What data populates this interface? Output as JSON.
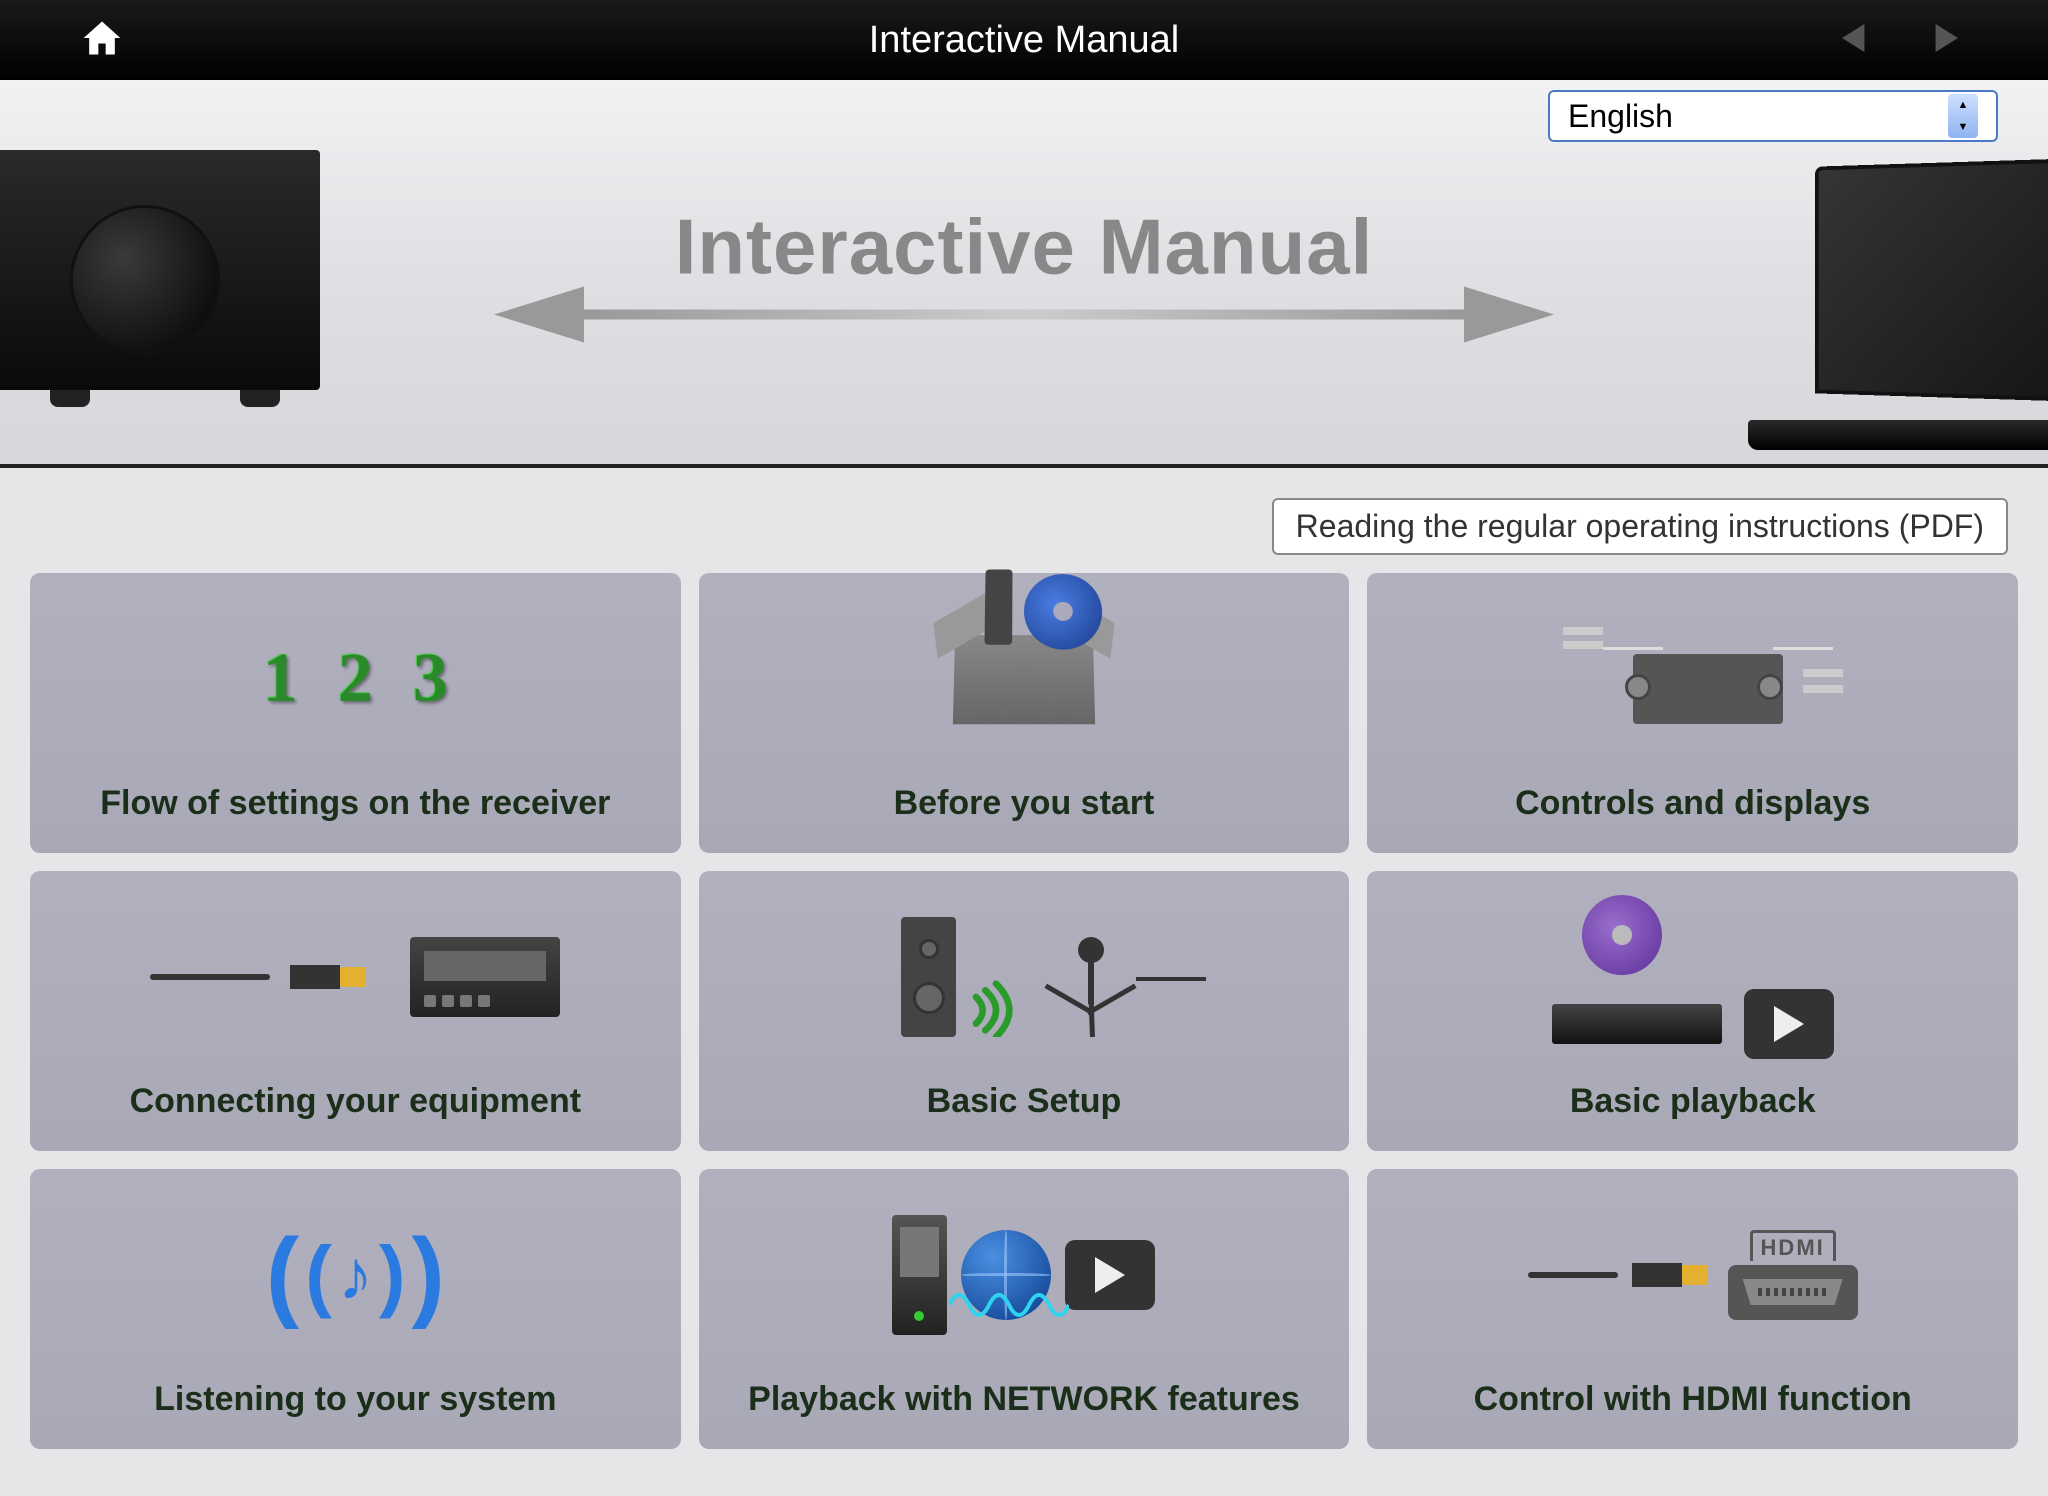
{
  "topbar": {
    "title": "Interactive Manual"
  },
  "language": {
    "selected": "English"
  },
  "hero": {
    "title": "Interactive Manual"
  },
  "pdf_link": "Reading the regular operating instructions (PDF)",
  "cards": [
    {
      "label": "Flow of settings on the receiver"
    },
    {
      "label": "Before you start"
    },
    {
      "label": "Controls and displays"
    },
    {
      "label": "Connecting your equipment"
    },
    {
      "label": "Basic Setup"
    },
    {
      "label": "Basic playback"
    },
    {
      "label": "Listening to your system"
    },
    {
      "label": "Playback with NETWORK features"
    },
    {
      "label": "Control with HDMI function"
    }
  ],
  "hdmi_label": "HDMI"
}
